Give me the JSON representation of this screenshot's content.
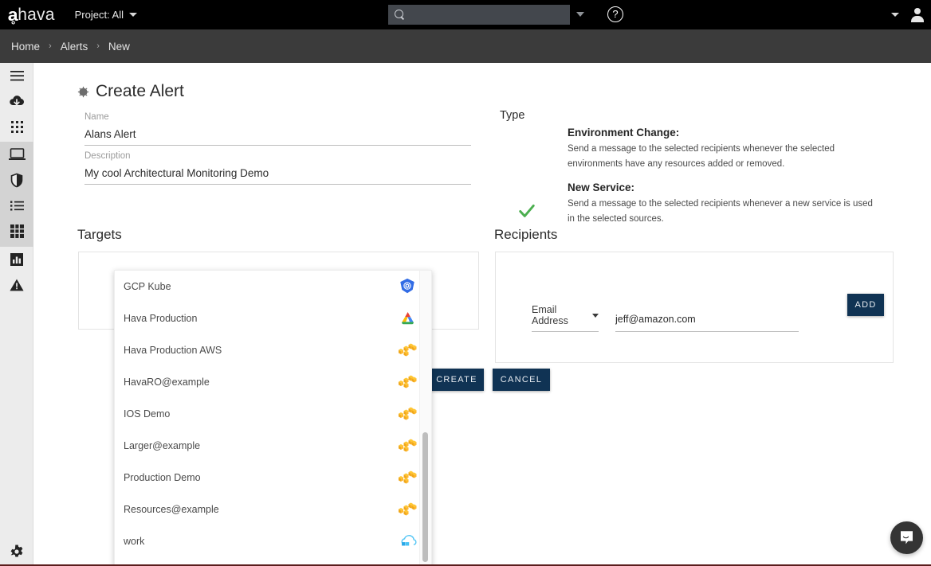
{
  "header": {
    "logo_mark": "ᘁ",
    "logo_text": "hava",
    "project_label": "Project: All",
    "search_value": "",
    "search_placeholder": "",
    "help_glyph": "?"
  },
  "breadcrumb": {
    "items": [
      "Home",
      "Alerts",
      "New"
    ],
    "separator": "›"
  },
  "sidebar": {
    "items": [
      {
        "name": "menu-icon",
        "label": "Menu"
      },
      {
        "name": "cloud-download-icon",
        "label": "Import"
      },
      {
        "name": "grid-apps-icon",
        "label": "Apps"
      },
      {
        "name": "laptop-icon",
        "label": "Environments"
      },
      {
        "name": "shield-icon",
        "label": "Security"
      },
      {
        "name": "list-icon",
        "label": "Lists"
      },
      {
        "name": "table-grid-icon",
        "label": "Tables"
      },
      {
        "name": "bar-chart-icon",
        "label": "Reports"
      },
      {
        "name": "alert-triangle-icon",
        "label": "Alerts"
      }
    ],
    "footer_item": {
      "name": "gear-icon",
      "label": "Settings"
    }
  },
  "page": {
    "title": "Create Alert",
    "title_icon": "alert-bell-icon"
  },
  "form": {
    "name": {
      "label": "Name",
      "value": "Alans Alert",
      "placeholder": ""
    },
    "description": {
      "label": "Description",
      "value": "My cool Architectural Monitoring Demo",
      "placeholder": ""
    }
  },
  "type": {
    "heading": "Type",
    "options": [
      {
        "title": "Environment Change:",
        "description": "Send a message to the selected recipients whenever the selected environments have any resources added or removed.",
        "selected": false
      },
      {
        "title": "New Service:",
        "description": "Send a message to the selected recipients whenever a new service is used in the selected sources.",
        "selected": true
      }
    ],
    "check_color": "#4caf50"
  },
  "targets": {
    "heading": "Targets",
    "dropdown_open": true,
    "options": [
      {
        "label": "GCP Kube",
        "icon": "kubernetes-icon"
      },
      {
        "label": "Hava Production",
        "icon": "gcp-cloud-icon"
      },
      {
        "label": "Hava Production AWS",
        "icon": "aws-icon"
      },
      {
        "label": "HavaRO@example",
        "icon": "aws-icon"
      },
      {
        "label": "IOS Demo",
        "icon": "aws-icon"
      },
      {
        "label": "Larger@example",
        "icon": "aws-icon"
      },
      {
        "label": "Production Demo",
        "icon": "aws-icon"
      },
      {
        "label": "Resources@example",
        "icon": "aws-icon"
      },
      {
        "label": "work",
        "icon": "azure-icon"
      }
    ]
  },
  "recipients": {
    "heading": "Recipients",
    "type_value": "Email Address",
    "email_value": "jeff@amazon.com",
    "email_placeholder": "",
    "add_label": "ADD"
  },
  "actions": {
    "create_label": "CREATE",
    "cancel_label": "CANCEL"
  },
  "chat": {
    "name": "messenger-icon"
  },
  "colors": {
    "topbar": "#000000",
    "breadcrumb_bar": "#3b3b3b",
    "rail": "#ececec",
    "rail_highlight": "#d3d3d3",
    "button_dark": "#103354",
    "check_green": "#4caf50"
  }
}
